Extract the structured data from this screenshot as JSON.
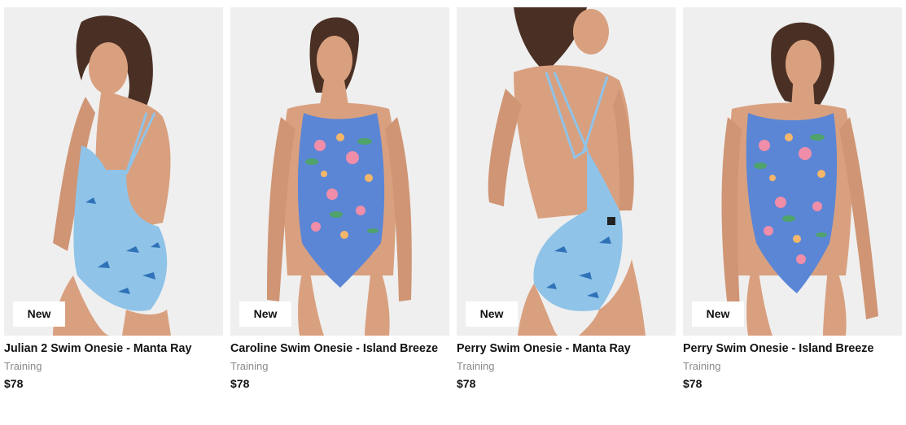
{
  "products": [
    {
      "name": "Julian 2 Swim Onesie - Manta Ray",
      "category": "Training",
      "price": "$78",
      "badge": "New",
      "print": "manta-ray"
    },
    {
      "name": "Caroline Swim Onesie - Island Breeze",
      "category": "Training",
      "price": "$78",
      "badge": "New",
      "print": "island-breeze"
    },
    {
      "name": "Perry Swim Onesie - Manta Ray",
      "category": "Training",
      "price": "$78",
      "badge": "New",
      "print": "manta-ray"
    },
    {
      "name": "Perry Swim Onesie - Island Breeze",
      "category": "Training",
      "price": "$78",
      "badge": "New",
      "print": "island-breeze"
    }
  ],
  "colors": {
    "manta_ray": "#8fc3e8",
    "island_breeze": "#5b86d6",
    "skin": "#d9a07f",
    "hair": "#4a3024",
    "badge_bg": "#ffffff",
    "muted_text": "#8a8a8a"
  }
}
